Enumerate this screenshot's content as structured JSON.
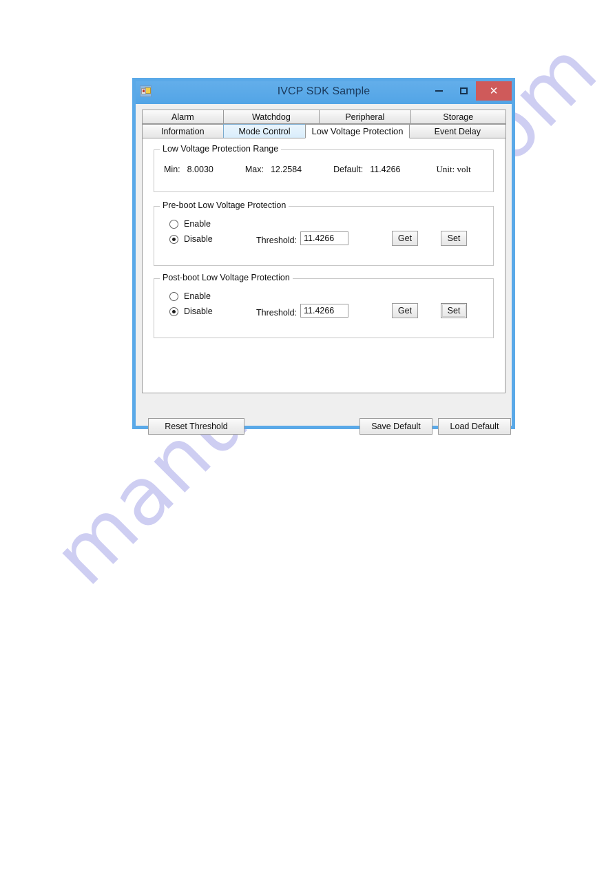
{
  "watermark": {
    "text": "manualshive.com"
  },
  "window": {
    "title": "IVCP SDK Sample",
    "icon": "application-icon",
    "controls": {
      "minimize": "–",
      "maximize": "□",
      "close": "✕"
    },
    "colors": {
      "title_bar": "#5aa9e8",
      "close_button": "#cf5a5a",
      "client_background": "#efefef",
      "panel_background": "#ffffff",
      "tab_hover": "#d9edfb"
    }
  },
  "tabs": {
    "row1": [
      {
        "label": "Alarm",
        "state": "normal"
      },
      {
        "label": "Watchdog",
        "state": "normal"
      },
      {
        "label": "Peripheral",
        "state": "normal"
      },
      {
        "label": "Storage",
        "state": "normal"
      }
    ],
    "row2": [
      {
        "label": "Information",
        "state": "normal"
      },
      {
        "label": "Mode Control",
        "state": "hover"
      },
      {
        "label": "Low Voltage Protection",
        "state": "selected"
      },
      {
        "label": "Event Delay",
        "state": "normal"
      }
    ]
  },
  "range_group": {
    "title": "Low Voltage Protection Range",
    "min_label": "Min:",
    "min_value": "8.0030",
    "max_label": "Max:",
    "max_value": "12.2584",
    "default_label": "Default:",
    "default_value": "11.4266",
    "unit": "Unit: volt"
  },
  "preboot": {
    "title": "Pre-boot Low Voltage Protection",
    "enable_label": "Enable",
    "disable_label": "Disable",
    "selected": "Disable",
    "threshold_label": "Threshold:",
    "threshold_value": "11.4266",
    "get_label": "Get",
    "set_label": "Set"
  },
  "postboot": {
    "title": "Post-boot Low Voltage Protection",
    "enable_label": "Enable",
    "disable_label": "Disable",
    "selected": "Disable",
    "threshold_label": "Threshold:",
    "threshold_value": "11.4266",
    "get_label": "Get",
    "set_label": "Set"
  },
  "bottom_bar": {
    "reset_label": "Reset Threshold",
    "save_label": "Save Default",
    "load_label": "Load Default"
  }
}
